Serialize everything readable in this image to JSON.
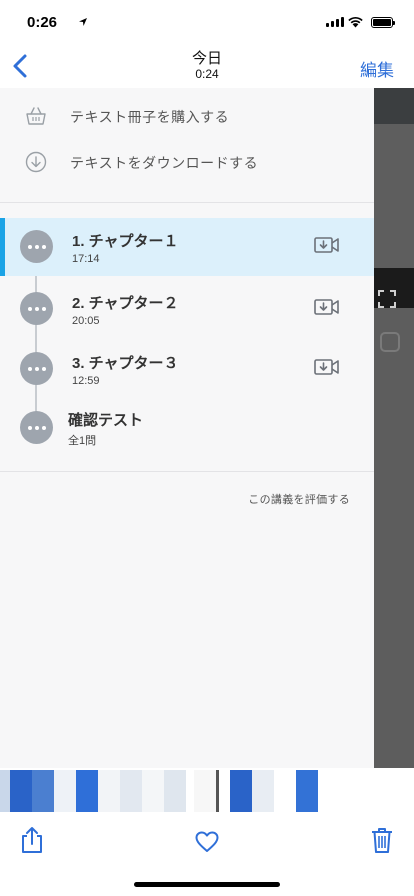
{
  "status_bar": {
    "time": "0:26"
  },
  "nav": {
    "title": "今日",
    "subtitle": "0:24",
    "edit_label": "編集"
  },
  "actions": [
    {
      "label": "テキスト冊子を購入する",
      "icon": "basket-icon"
    },
    {
      "label": "テキストをダウンロードする",
      "icon": "download-circle-icon"
    }
  ],
  "chapters": [
    {
      "title": "1. チャプター１",
      "meta": "17:14",
      "active": true
    },
    {
      "title": "2. チャプター２",
      "meta": "20:05",
      "active": false
    },
    {
      "title": "3. チャプター３",
      "meta": "12:59",
      "active": false
    },
    {
      "title": "確認テスト",
      "meta": "全1問",
      "active": false
    }
  ],
  "rate_label": "この講義を評価する",
  "colors": {
    "accent": "#1aa3e6",
    "active_bg": "#dcf0fb",
    "link": "#2f6fd8"
  },
  "toolbar": {
    "icons": [
      "share-icon",
      "heart-icon",
      "trash-icon"
    ]
  }
}
